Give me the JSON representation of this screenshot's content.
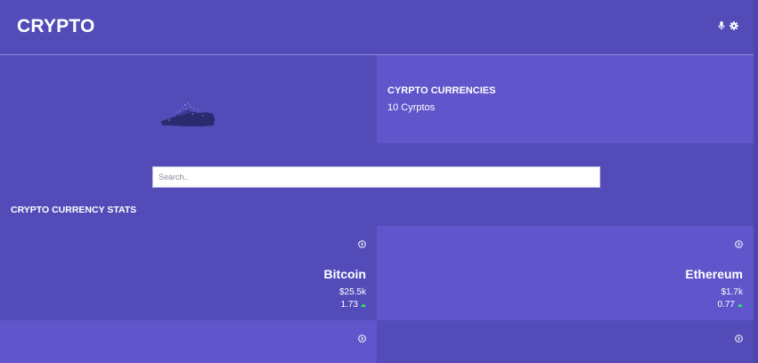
{
  "header": {
    "brand": "CRYPTO",
    "icons": [
      "microphone-icon",
      "gear-icon"
    ]
  },
  "hero": {
    "title": "CYRPTO CURRENCIES",
    "subtitle": "10 Cyrptos"
  },
  "search": {
    "placeholder": "Search..",
    "value": ""
  },
  "stats": {
    "section_title": "CRYPTO CURRENCY STATS",
    "coins": [
      {
        "name": "Bitcoin",
        "price": "$25.5k",
        "change": "1.73",
        "trend": "up"
      },
      {
        "name": "Ethereum",
        "price": "$1.7k",
        "change": "0.77",
        "trend": "up"
      },
      {
        "name": "",
        "price": "",
        "change": "",
        "trend": ""
      },
      {
        "name": "",
        "price": "",
        "change": "",
        "trend": ""
      }
    ]
  },
  "colors": {
    "background": "#534cb8",
    "panel_light": "#6055cb",
    "positive": "#2ee06a",
    "text": "#ffffff"
  }
}
